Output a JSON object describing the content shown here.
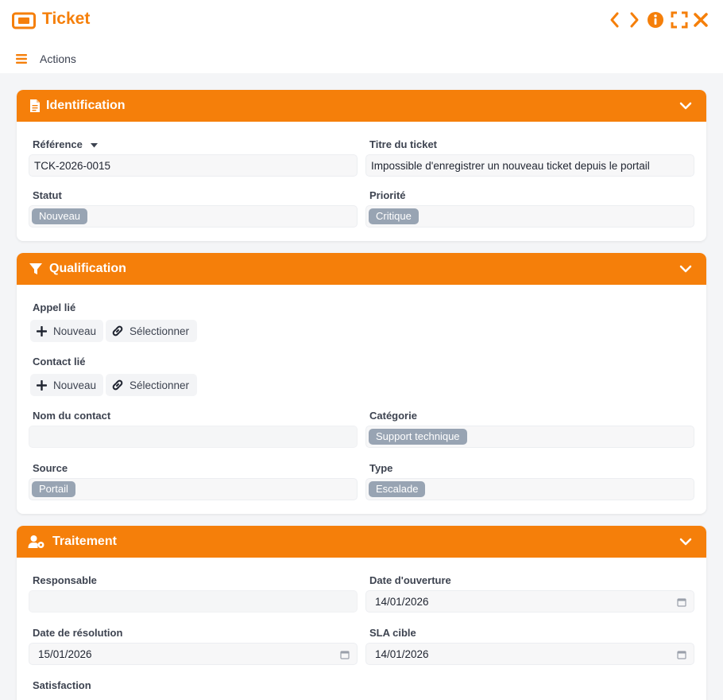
{
  "window": {
    "title": "Ticket",
    "accent": "#f57f0a",
    "menu_label": "Actions"
  },
  "identification": {
    "title": "Identification",
    "reference_label": "Référence",
    "reference_value": "TCK-2026-0015",
    "title_label": "Titre du ticket",
    "title_value": "Impossible d'enregistrer un nouveau ticket depuis le portail",
    "status_label": "Statut",
    "status_value": "Nouveau",
    "priority_label": "Priorité",
    "priority_value": "Critique"
  },
  "qualification": {
    "title": "Qualification",
    "call_label": "Appel lié",
    "contact_label": "Contact lié",
    "new_label": "Nouveau",
    "select_label": "Sélectionner",
    "contact_name_label": "Nom du contact",
    "contact_name_value": "",
    "category_label": "Catégorie",
    "category_value": "Support technique",
    "source_label": "Source",
    "source_value": "Portail",
    "type_label": "Type",
    "type_value": "Escalade"
  },
  "traitement": {
    "title": "Traitement",
    "owner_label": "Responsable",
    "owner_value": "",
    "opening_label": "Date d'ouverture",
    "opening_value": "14/01/2026",
    "resolution_label": "Date de résolution",
    "resolution_value": "15/01/2026",
    "sla_label": "SLA cible",
    "sla_value": "14/01/2026",
    "satisfaction_label": "Satisfaction"
  }
}
